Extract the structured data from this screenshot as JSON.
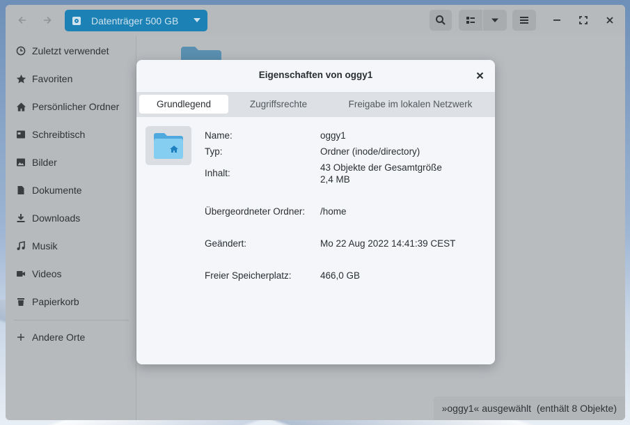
{
  "headerbar": {
    "back_icon": "arrow-left-icon",
    "forward_icon": "arrow-right-icon",
    "location_label": "Datenträger 500 GB",
    "search_icon": "search-icon",
    "view_icon": "list-view-icon",
    "view_dropdown_icon": "chevron-down-icon",
    "menu_icon": "hamburger-menu-icon",
    "minimize_icon": "minimize-icon",
    "maximize_icon": "maximize-icon",
    "close_icon": "close-icon"
  },
  "sidebar": {
    "items": [
      {
        "label": "Zuletzt verwendet",
        "icon": "clock-icon"
      },
      {
        "label": "Favoriten",
        "icon": "star-icon"
      },
      {
        "label": "Persönlicher Ordner",
        "icon": "home-icon"
      },
      {
        "label": "Schreibtisch",
        "icon": "desktop-icon"
      },
      {
        "label": "Bilder",
        "icon": "pictures-icon"
      },
      {
        "label": "Dokumente",
        "icon": "document-icon"
      },
      {
        "label": "Downloads",
        "icon": "download-icon"
      },
      {
        "label": "Musik",
        "icon": "music-icon"
      },
      {
        "label": "Videos",
        "icon": "video-icon"
      },
      {
        "label": "Papierkorb",
        "icon": "trash-icon"
      },
      {
        "label": "Andere Orte",
        "icon": "plus-icon"
      }
    ]
  },
  "statusbar": {
    "text": "»oggy1« ausgewählt  (enthält 8 Objekte)"
  },
  "dialog": {
    "title": "Eigenschaften von oggy1",
    "tabs": [
      {
        "label": "Grundlegend",
        "active": true
      },
      {
        "label": "Zugriffsrechte",
        "active": false
      },
      {
        "label": "Freigabe im lokalen Netzwerk",
        "active": false
      }
    ],
    "properties": {
      "name_label": "Name:",
      "name_value": "oggy1",
      "type_label": "Typ:",
      "type_value": "Ordner (inode/directory)",
      "content_label": "Inhalt:",
      "content_value_line1": "43 Objekte der Gesamtgröße",
      "content_value_line2": "2,4 MB",
      "parent_label": "Übergeordneter Ordner:",
      "parent_value": "/home",
      "modified_label": "Geändert:",
      "modified_value": "Mo 22 Aug 2022 14:41:39 CEST",
      "free_label": "Freier Speicherplatz:",
      "free_value": "466,0 GB"
    }
  },
  "colors": {
    "accent": "#1c81b5",
    "folder": "#7ec4ec",
    "dialog_bg": "#f4f6fa"
  }
}
